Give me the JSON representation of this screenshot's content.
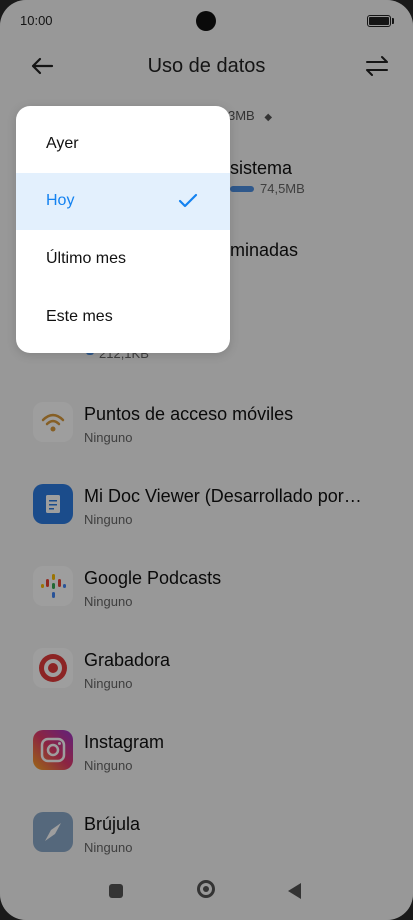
{
  "status": {
    "time": "10:00"
  },
  "header": {
    "title": "Uso de datos"
  },
  "summary": {
    "total": "3MB",
    "arrow": "⌃⌄"
  },
  "background_items": [
    {
      "name": "sistema",
      "value": "74,5MB"
    },
    {
      "name": "minadas",
      "value": "212,1KB"
    }
  ],
  "apps": [
    {
      "name": "Puntos de acceso móviles",
      "sub": "Ninguno"
    },
    {
      "name": "Mi Doc Viewer (Desarrollado por…",
      "sub": "Ninguno"
    },
    {
      "name": "Google Podcasts",
      "sub": "Ninguno"
    },
    {
      "name": "Grabadora",
      "sub": "Ninguno"
    },
    {
      "name": "Instagram",
      "sub": "Ninguno"
    },
    {
      "name": "Brújula",
      "sub": "Ninguno"
    }
  ],
  "menu": {
    "items": [
      {
        "label": "Ayer"
      },
      {
        "label": "Hoy"
      },
      {
        "label": "Último mes"
      },
      {
        "label": "Este mes"
      }
    ]
  },
  "colors": {
    "accent": "#1482f0",
    "selected_bg": "#e3f0fd",
    "bar": "#4d8fe0"
  }
}
